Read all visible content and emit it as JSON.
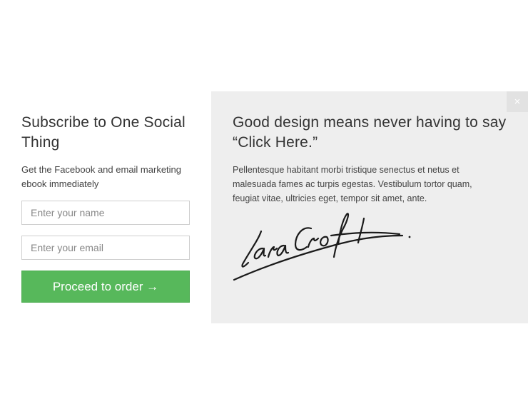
{
  "optin": {
    "title": "Subscribe to One Social Thing",
    "description": "Get the Facebook and email marketing ebook immediately",
    "name_placeholder": "Enter your name",
    "email_placeholder": "Enter your email",
    "button_label": "Proceed to order →",
    "button_color": "#57b85b"
  },
  "feature": {
    "close_label": "×",
    "headline": "Good design means never having to say “Click Here.”",
    "body": "Pellentesque habitant morbi tristique senectus et netus et malesuada fames ac turpis egestas. Vestibulum tortor quam, feugiat vitae, ultricies eget, tempor sit amet, ante.",
    "signature_text": "LaraCroft",
    "panel_color": "#eeeeee"
  }
}
